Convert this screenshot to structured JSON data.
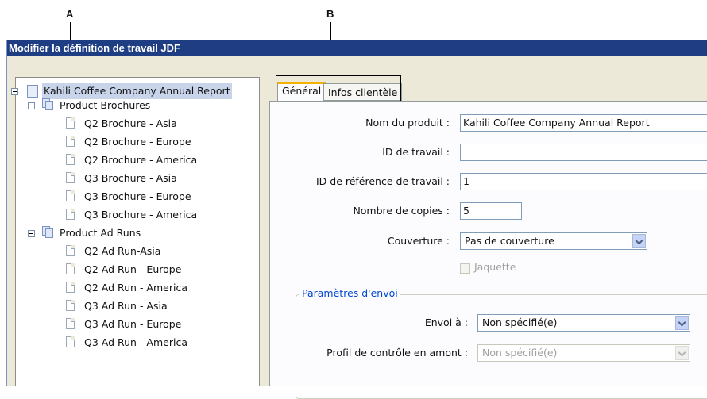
{
  "callouts": {
    "a": "A",
    "b": "B"
  },
  "window": {
    "title": "Modifier la définition de travail JDF"
  },
  "tree": {
    "root": {
      "label": "Kahili Coffee Company Annual Report"
    },
    "groups": [
      {
        "label": "Product Brochures",
        "items": [
          "Q2 Brochure - Asia",
          "Q2 Brochure - Europe",
          "Q2 Brochure - America",
          "Q3 Brochure - Asia",
          "Q3 Brochure - Europe",
          "Q3 Brochure - America"
        ]
      },
      {
        "label": "Product Ad Runs",
        "items": [
          "Q2 Ad Run-Asia",
          "Q2 Ad Run - Europe",
          "Q2 Ad Run - America",
          "Q3 Ad Run - Asia",
          "Q3 Ad Run - Europe",
          "Q3 Ad Run - America"
        ]
      }
    ]
  },
  "tabs": {
    "general": "Général",
    "customer": "Infos clientèle"
  },
  "form": {
    "product_name": {
      "label": "Nom du produit :",
      "value": "Kahili Coffee Company Annual Report"
    },
    "job_id": {
      "label": "ID de travail :",
      "value": ""
    },
    "job_ref_id": {
      "label": "ID de référence de travail :",
      "value": "1"
    },
    "copies": {
      "label": "Nombre de copies :",
      "value": "5"
    },
    "cover": {
      "label": "Couverture :",
      "value": "Pas de couverture"
    },
    "jacket": {
      "label": "Jaquette",
      "checked": false
    },
    "submission": {
      "title": "Paramètres d'envoi",
      "send_to": {
        "label": "Envoi à :",
        "value": "Non spécifié(e)"
      },
      "preflight": {
        "label": "Profil de contrôle en amont :",
        "value": "Non spécifié(e)"
      }
    }
  },
  "colors": {
    "titlebar": "#1f3d82",
    "tab_highlight": "#f4b200",
    "group_title": "#0046d5"
  }
}
